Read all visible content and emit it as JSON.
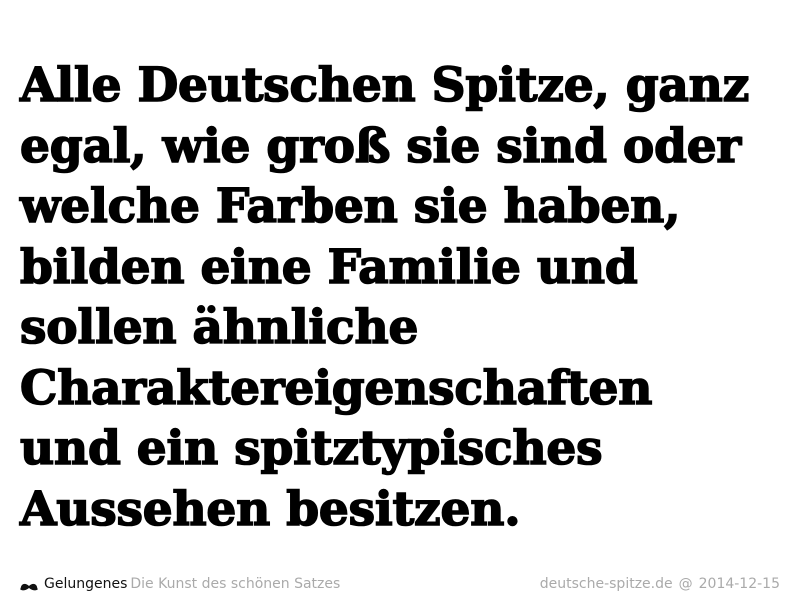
{
  "quote": {
    "lines": [
      "Alle Deutschen Spitze, ganz",
      "egal, wie groß sie sind oder",
      "welche Farben sie haben,",
      "bilden eine Familie und",
      "sollen ähnliche",
      "Charaktereigenschaften",
      "und ein spitztypisches",
      "Aussehen besitzen."
    ]
  },
  "footer": {
    "brand_icon": "mustache-icon",
    "brand_name": "Gelungenes",
    "brand_tagline": "Die Kunst des schönen Satzes",
    "source": "deutsche-spitze.de",
    "separator": "@",
    "date": "2014-12-15"
  },
  "colors": {
    "text": "#000000",
    "muted": "#aaaaaa",
    "background": "#ffffff"
  }
}
